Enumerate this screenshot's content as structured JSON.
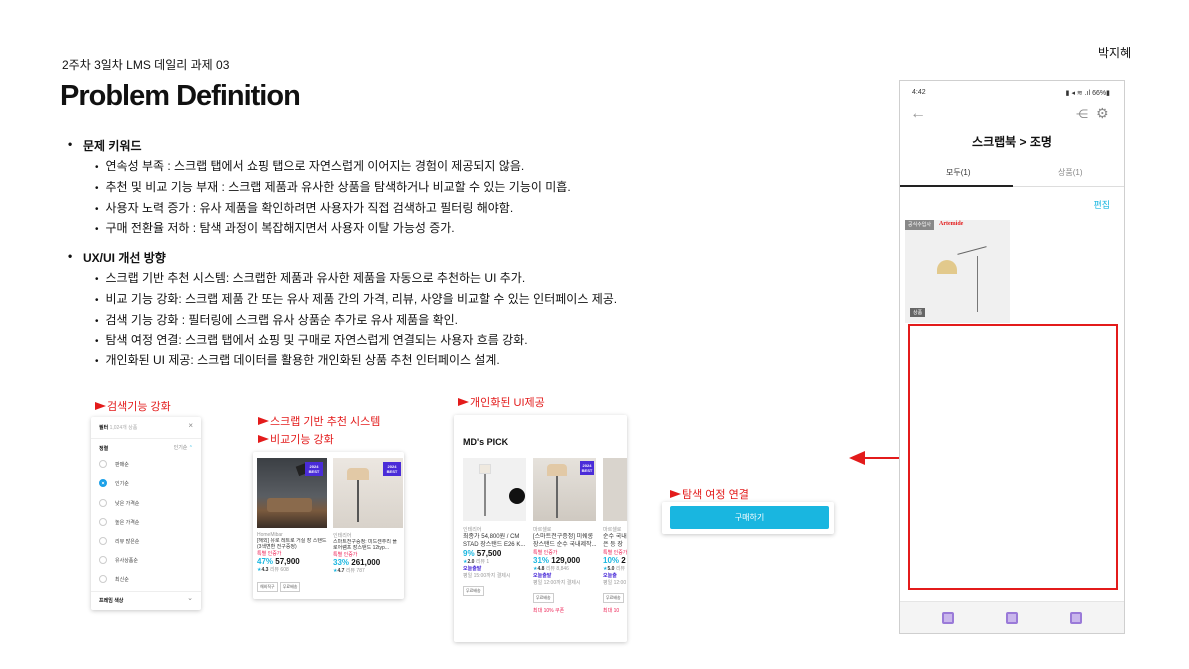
{
  "author": "박지혜",
  "subtitle": "2주차 3일차  LMS 데일리 과제 03",
  "title": "Problem Definition",
  "sections": [
    {
      "heading": "문제 키워드",
      "items": [
        "연속성 부족 :  스크랩 탭에서 쇼핑 탭으로 자연스럽게 이어지는 경험이 제공되지 않음.",
        "추천 및 비교 기능 부재 : 스크랩 제품과 유사한 상품을 탐색하거나 비교할 수 있는 기능이 미흡.",
        "사용자 노력 증가 : 유사 제품을 확인하려면 사용자가 직접 검색하고 필터링 해야함.",
        "구매 전환율 저하 : 탐색 과정이 복잡해지면서 사용자 이탈 가능성 증가."
      ]
    },
    {
      "heading": "UX/UI 개선 방향",
      "items": [
        "스크랩 기반 추천 시스템: 스크랩한 제품과 유사한 제품을 자동으로 추천하는 UI 추가.",
        "비교 기능 강화: 스크랩 제품 간 또는 유사 제품 간의 가격, 리뷰, 사양을 비교할 수 있는 인터페이스 제공.",
        "검색 기능 강화 : 필터링에 스크랩 유사 상품순 추가로 유사 제품을 확인.",
        "탐색 여정 연결: 스크랩 탭에서 쇼핑 및 구매로 자연스럽게 연결되는 사용자 흐름 강화.",
        "개인화된 UI 제공: 스크랩 데이터를 활용한 개인화된 상품 추천 인터페이스 설계."
      ]
    }
  ],
  "annotations": {
    "search": "검색기능 강화",
    "recommend": "스크랩 기반 추천 시스템",
    "compare": "비교기능 강화",
    "personal": "개인화된 UI제공",
    "journey": "탐색 여정 연결"
  },
  "filter_card": {
    "title": "필터",
    "title_note": "1,024개 상품",
    "sort_label": "정렬",
    "sort_value": "인기순",
    "options": [
      "판매순",
      "인기순",
      "낮은 가격순",
      "높은 가격순",
      "리뷰 많은순",
      "유사상품순",
      "최신순"
    ],
    "selected_index": 1,
    "footer": "프레임 색상"
  },
  "compare_card": {
    "products": [
      {
        "brand": "HomeMibar",
        "name": "[해외] 유로 레트로 거실 장 스탠드 (3색변환 전구증정)",
        "tag": "특별 인증가",
        "discount": "47%",
        "price": "57,900",
        "rating": "4.3",
        "reviews": "리뷰 608",
        "chips": [
          "해외직구",
          "무료배송"
        ],
        "badge": "2024 BEST"
      },
      {
        "brand": "인테리어",
        "name": "스마트전구증정: 미드센추리 플로어램프 장스탠드 12typ...",
        "tag": "특별 인증가",
        "discount": "33%",
        "price": "261,000",
        "rating": "4.7",
        "reviews": "리뷰 787",
        "chips": [],
        "badge": "2024 BEST"
      }
    ]
  },
  "mds_card": {
    "title": "MD's PICK",
    "products": [
      {
        "brand": "인테리어",
        "name": "최종가 54,800원 / CM STAD 장스탠드 E26 K...",
        "discount": "9%",
        "price": "57,500",
        "rating": "2.0",
        "reviews": "리뷰 1",
        "store": "오늘출발",
        "ship": "평일 15:00까지 결제시",
        "chips": [
          "무료배송"
        ],
        "coupon": ""
      },
      {
        "brand": "마르셀로",
        "name": "[스마트전구증정] 미쉐롱 장스탠드 순수 국내제작...",
        "tag": "특별 인증가",
        "discount": "31%",
        "price": "129,000",
        "rating": "4.8",
        "reviews": "리뷰 8,846",
        "store": "오늘출발",
        "ship": "평일 12:00까지 결제시",
        "chips": [
          "무료배송"
        ],
        "coupon": "최대 10% 쿠폰",
        "badge": "2024 BEST"
      },
      {
        "brand": "마르셀로",
        "name": "순수 국내 은 등 장 ...",
        "tag": "특별 인증가",
        "discount": "10%",
        "price": "2",
        "rating": "5.0",
        "reviews": "리뷰",
        "store": "오늘출",
        "ship": "평일 12:00",
        "chips": [
          "무료배송"
        ],
        "coupon": "최대 10"
      }
    ]
  },
  "buy_button": "구매하기",
  "phone": {
    "time": "4:42",
    "battery": "66%",
    "header": "스크랩북 > 조명",
    "tabs": [
      "모두(1)",
      "상품(1)"
    ],
    "edit": "편집",
    "item_tag": "상품",
    "item_brand": "Artemide",
    "item_note": "공식수입사"
  },
  "colors": {
    "accent": "#19b6e0",
    "annotation": "#e31b1b",
    "badge": "#4a2cd8"
  }
}
